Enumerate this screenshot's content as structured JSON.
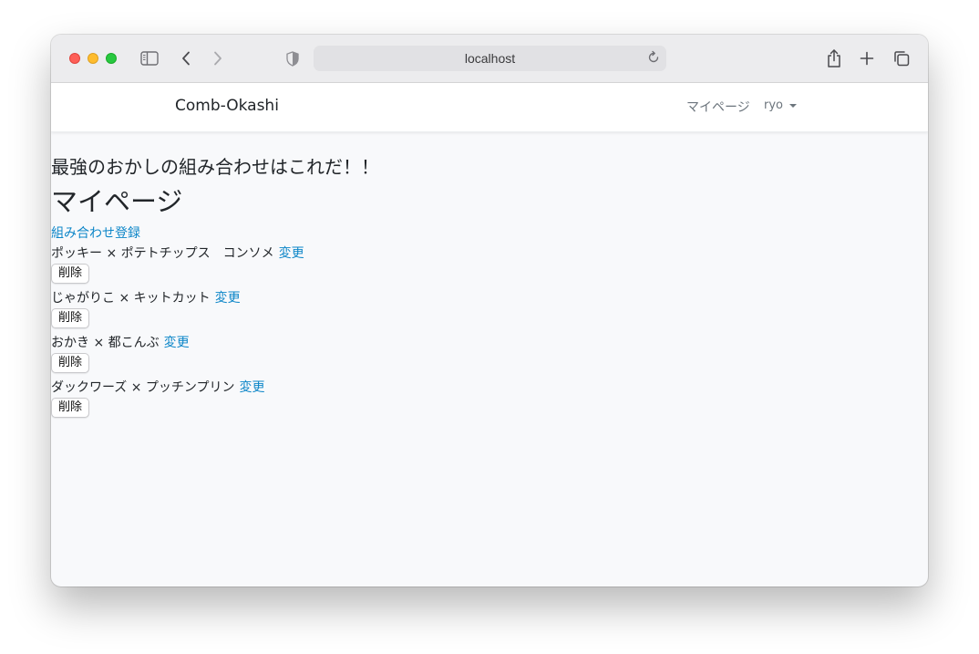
{
  "browser": {
    "url": "localhost",
    "icons": {
      "sidebar": "sidebar-icon",
      "back": "chevron-left-icon",
      "forward": "chevron-right-icon",
      "privacy": "shield-icon",
      "reload": "reload-icon",
      "share": "share-icon",
      "new_tab": "plus-icon",
      "tabs": "tabs-overview-icon"
    },
    "traffic_lights": {
      "red": "#fe5f57",
      "yellow": "#febc2e",
      "green": "#28c840"
    }
  },
  "navbar": {
    "brand": "Comb-Okashi",
    "mypage": "マイページ",
    "user": "ryo"
  },
  "main": {
    "lead": "最強のおかしの組み合わせはこれだ！！",
    "title": "マイページ",
    "register_link": "組み合わせ登録",
    "combinations": [
      {
        "text": "ポッキー × ポテトチップス　コンソメ",
        "edit": "変更",
        "delete": "削除"
      },
      {
        "text": "じゃがりこ × キットカット",
        "edit": "変更",
        "delete": "削除"
      },
      {
        "text": "おかき × 都こんぶ",
        "edit": "変更",
        "delete": "削除"
      },
      {
        "text": "ダックワーズ × プッチンプリン",
        "edit": "変更",
        "delete": "削除"
      }
    ]
  },
  "colors": {
    "link": "#0d86c8",
    "text": "#212529",
    "muted": "#6c757d",
    "page_bg": "#f8f9fb"
  }
}
